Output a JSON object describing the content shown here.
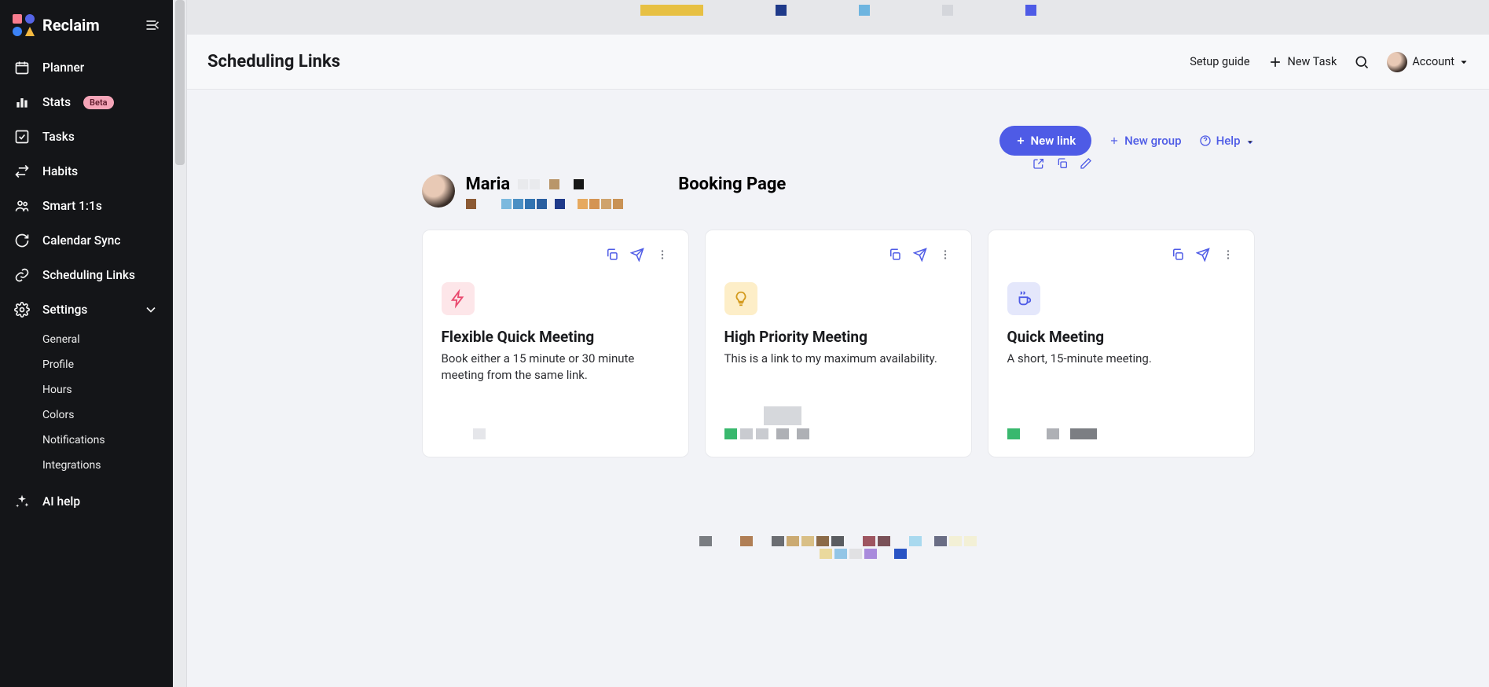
{
  "brand": "Reclaim",
  "sidebar": {
    "items": [
      {
        "label": "Planner",
        "icon": "calendar"
      },
      {
        "label": "Stats",
        "icon": "bar-chart",
        "badge": "Beta"
      },
      {
        "label": "Tasks",
        "icon": "check-square"
      },
      {
        "label": "Habits",
        "icon": "repeat"
      },
      {
        "label": "Smart 1:1s",
        "icon": "users"
      },
      {
        "label": "Calendar Sync",
        "icon": "refresh"
      },
      {
        "label": "Scheduling Links",
        "icon": "link"
      },
      {
        "label": "Settings",
        "icon": "gear",
        "expandable": true
      }
    ],
    "settings_sub": [
      "General",
      "Profile",
      "Hours",
      "Colors",
      "Notifications",
      "Integrations"
    ],
    "ai_help": "AI help"
  },
  "topbar": {
    "title": "Scheduling Links",
    "setup_guide": "Setup guide",
    "new_task": "New Task",
    "account": "Account"
  },
  "actions": {
    "new_link": "New link",
    "new_group": "New group",
    "help": "Help"
  },
  "profile": {
    "name": "Maria",
    "booking_page": "Booking Page"
  },
  "cards": [
    {
      "title": "Flexible Quick Meeting",
      "desc": "Book either a 15 minute or 30 minute meeting from the same link.",
      "icon": "bolt",
      "icon_style": "pink"
    },
    {
      "title": "High Priority Meeting",
      "desc": "This is a link to my maximum availability.",
      "icon": "lightbulb",
      "icon_style": "yellow"
    },
    {
      "title": "Quick Meeting",
      "desc": "A short, 15-minute meeting.",
      "icon": "coffee",
      "icon_style": "blue"
    }
  ]
}
